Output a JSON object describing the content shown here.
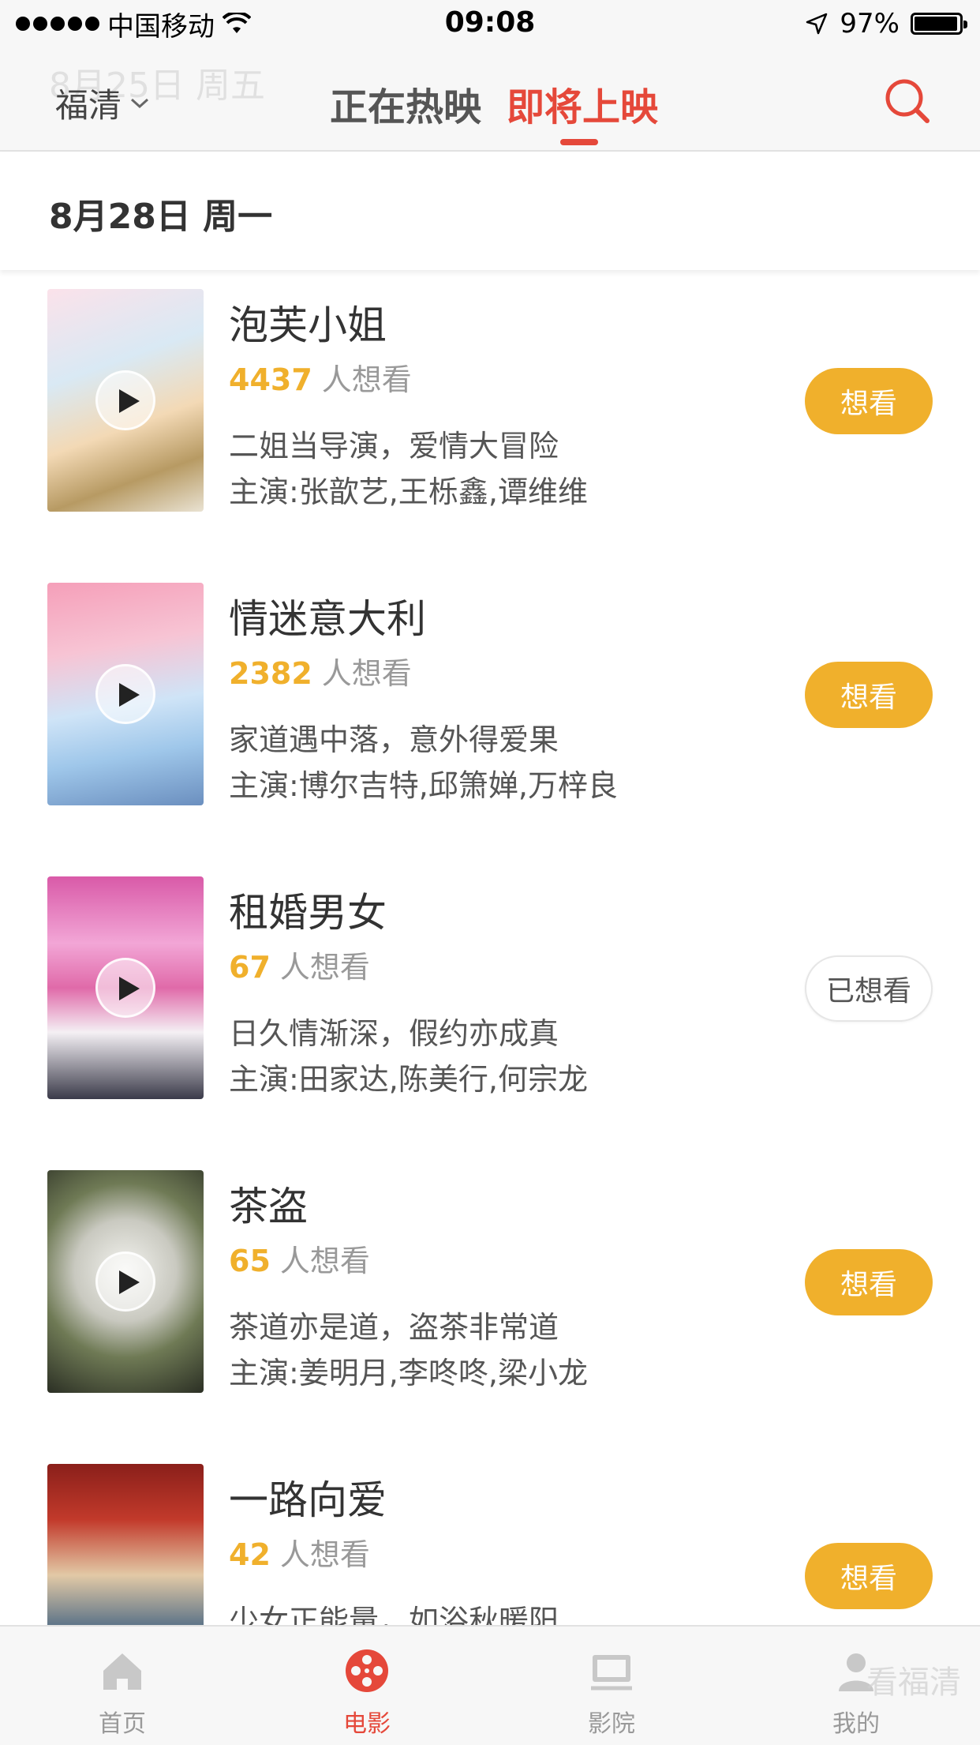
{
  "status": {
    "carrier": "中国移动",
    "time": "09:08",
    "battery": "97%",
    "battery_level": 0.97
  },
  "header": {
    "ghost_date": "8月25日 周五",
    "city": "福清",
    "tabs": [
      {
        "label": "正在热映",
        "active": false
      },
      {
        "label": "即将上映",
        "active": true
      }
    ],
    "icons": {
      "search": "search-icon",
      "city_dropdown": "chevron-down-icon"
    }
  },
  "date_header": "8月28日 周一",
  "colors": {
    "accent": "#e5483a",
    "want_button": "#f0b02c",
    "count": "#f0b02c"
  },
  "movies": [
    {
      "title": "泡芙小姐",
      "count": "4437",
      "want_suffix": "人想看",
      "desc": "二姐当导演，爱情大冒险",
      "cast": "主演:张歆艺,王栎鑫,谭维维",
      "button": "想看"
    },
    {
      "title": "情迷意大利",
      "count": "2382",
      "want_suffix": "人想看",
      "desc": "家道遇中落，意外得爱果",
      "cast": "主演:博尔吉特,邱箫婵,万梓良",
      "button": "想看"
    },
    {
      "title": "租婚男女",
      "count": "67",
      "want_suffix": "人想看",
      "desc": "日久情渐深，假约亦成真",
      "cast": "主演:田家达,陈美行,何宗龙",
      "button": "已想看"
    },
    {
      "title": "茶盗",
      "count": "65",
      "want_suffix": "人想看",
      "desc": "茶道亦是道，盗茶非常道",
      "cast": "主演:姜明月,李咚咚,梁小龙",
      "button": "想看"
    },
    {
      "title": "一路向爱",
      "count": "42",
      "want_suffix": "人想看",
      "desc": "少女正能量，如浴秋暖阳",
      "cast": "",
      "button": "想看"
    }
  ],
  "tabbar": [
    {
      "label": "首页",
      "icon": "home-icon"
    },
    {
      "label": "电影",
      "icon": "film-reel-icon",
      "active": true
    },
    {
      "label": "影院",
      "icon": "cinema-screen-icon"
    },
    {
      "label": "我的",
      "icon": "user-icon"
    }
  ],
  "watermark": "看福清"
}
